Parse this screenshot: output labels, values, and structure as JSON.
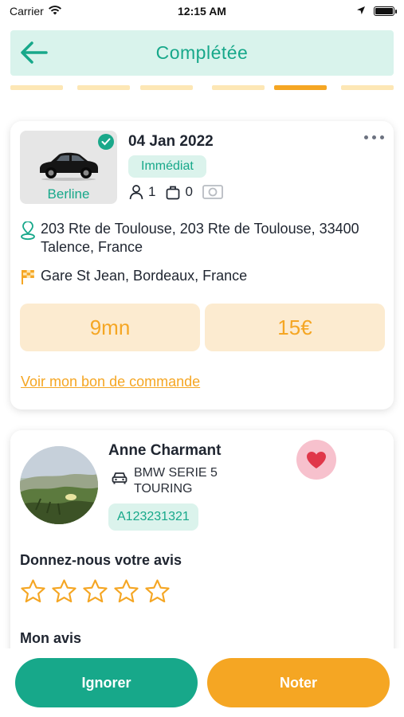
{
  "status_bar": {
    "carrier": "Carrier",
    "time": "12:15 AM"
  },
  "header": {
    "title": "Complétée",
    "back_icon": "arrow-left-icon"
  },
  "progress": {
    "total_steps": 6,
    "active_step": 5
  },
  "trip": {
    "vehicle_type": "Berline",
    "date": "04 Jan 2022",
    "mode": "Immédiat",
    "passengers": "1",
    "luggage": "0",
    "pickup": "203 Rte de Toulouse, 203 Rte de Toulouse, 33400 Talence, France",
    "dropoff": "Gare St Jean, Bordeaux, France",
    "duration": "9mn",
    "price": "15€",
    "order_link": "Voir mon bon de commande"
  },
  "driver": {
    "name": "Anne Charmant",
    "car_line1": "BMW SERIE 5",
    "car_line2": "TOURING",
    "plate": "A123231321",
    "review_title": "Donnez-nous votre avis",
    "rating": 0,
    "max_rating": 5,
    "my_review_title": "Mon avis"
  },
  "actions": {
    "ignore_label": "Ignorer",
    "rate_label": "Noter"
  },
  "colors": {
    "primary": "#17a88a",
    "accent": "#f5a623",
    "header_bg": "#d9f3ec",
    "favorite": "#e0374a"
  }
}
